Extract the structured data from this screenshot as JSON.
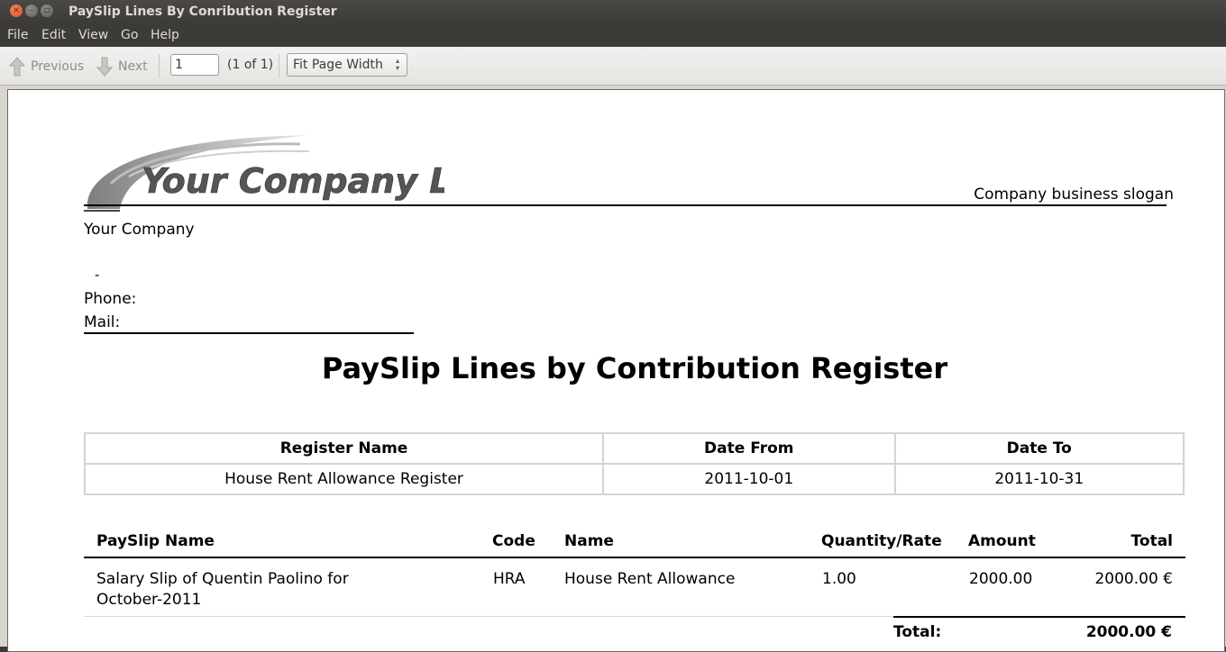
{
  "window": {
    "title": "PaySlip Lines By Conribution Register",
    "buttons": [
      "close-icon",
      "minimize-icon",
      "maximize-icon"
    ]
  },
  "menu": [
    "File",
    "Edit",
    "View",
    "Go",
    "Help"
  ],
  "toolbar": {
    "previous_label": "Previous",
    "next_label": "Next",
    "page_value": "1",
    "page_count": "(1 of 1)",
    "zoom_value": "Fit Page Width"
  },
  "document": {
    "logo_text": "Your Company Logo",
    "slogan": "Company business slogan",
    "company_name": "Your Company",
    "address_dash": "-",
    "phone_label": "Phone:",
    "mail_label": "Mail:",
    "title": "PaySlip Lines by Contribution Register",
    "register_table": {
      "headers": [
        "Register Name",
        "Date From",
        "Date To"
      ],
      "row": [
        "House Rent Allowance Register",
        "2011-10-01",
        "2011-10-31"
      ]
    },
    "lines_table": {
      "headers": [
        "PaySlip Name",
        "Code",
        "Name",
        "Quantity/Rate",
        "Amount",
        "Total"
      ],
      "rows": [
        {
          "payslip_name_line1": "Salary Slip of Quentin Paolino for",
          "payslip_name_line2": "October-2011",
          "code": "HRA",
          "name": "House Rent Allowance",
          "quantity_rate": "1.00",
          "amount": "2000.00",
          "total": "2000.00 €"
        }
      ],
      "total_label": "Total:",
      "total_value": "2000.00 €"
    }
  }
}
